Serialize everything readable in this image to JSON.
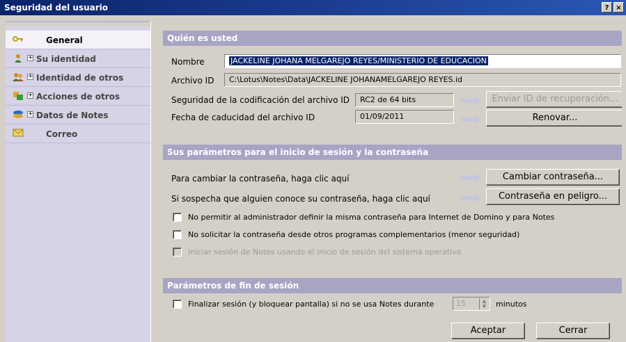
{
  "window": {
    "title": "Seguridad del usuario",
    "help_label": "?",
    "close_label": "×"
  },
  "sidebar": {
    "items": [
      {
        "label": "General",
        "icon": "key-icon",
        "expand": "",
        "selected": true
      },
      {
        "label": "Su identidad",
        "icon": "person-icon",
        "expand": "+"
      },
      {
        "label": "Identidad de otros",
        "icon": "people-icon",
        "expand": "+"
      },
      {
        "label": "Acciones de otros",
        "icon": "keys-icon",
        "expand": "+"
      },
      {
        "label": "Datos de Notes",
        "icon": "data-icon",
        "expand": "+"
      },
      {
        "label": "Correo",
        "icon": "mail-icon",
        "expand": ""
      }
    ]
  },
  "who": {
    "heading": "Quién es usted",
    "name_label": "Nombre",
    "name_value": "JACKELINE JOHANA MELGAREJO REYES/MINISTERIO DE EDUCACION",
    "file_label": "Archivo ID",
    "file_value": "C:\\Lotus\\Notes\\Data\\JACKELINE JOHANAMELGAREJO REYES.id",
    "security_label": "Seguridad de la codificación del archivo ID",
    "security_value": "RC2 de 64 bits",
    "send_recovery_button": "Enviar ID de recuperación...",
    "expiry_label": "Fecha de caducidad del archivo ID",
    "expiry_value": "01/09/2011",
    "renew_button": "Renovar..."
  },
  "login": {
    "heading": "Sus parámetros para el inicio de sesión y la contraseña",
    "change_label": "Para cambiar la contraseña, haga clic aquí",
    "change_button": "Cambiar contraseña...",
    "compromised_label": "Si sospecha que alguien conoce su contraseña, haga clic aquí",
    "compromised_button": "Contraseña en peligro...",
    "options": [
      {
        "label": "No permitir al administrador definir la misma contraseña para Internet de Domino y para Notes",
        "checked": false,
        "enabled": true
      },
      {
        "label": "No solicitar la contraseña desde otros programas complementarios (menor seguridad)",
        "checked": false,
        "enabled": true
      },
      {
        "label": "Iniciar sesión de Notes usando el inicio de sesión del sistema operativo",
        "checked": false,
        "enabled": false
      }
    ]
  },
  "logout": {
    "heading": "Parámetros de fin de sesión",
    "option_label": "Finalizar sesión (y bloquear pantalla) si no se usa Notes durante",
    "minutes_value": "15",
    "minutes_label": "minutos"
  },
  "footer": {
    "ok_button": "Aceptar",
    "close_button": "Cerrar"
  },
  "colors": {
    "titlebar": "#0a246a",
    "section_header": "#a8a4c4",
    "sidebar": "#d6d3e6",
    "arrow": "#c8c6dc"
  }
}
